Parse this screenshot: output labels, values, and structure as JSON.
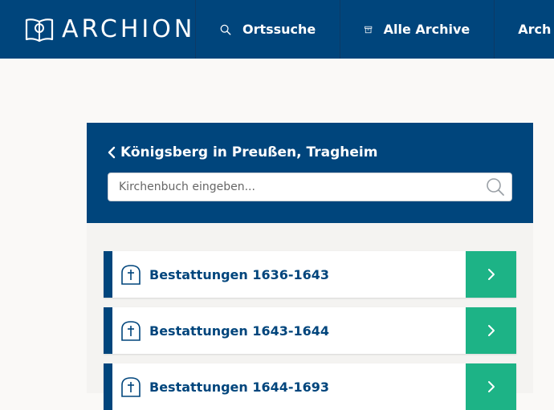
{
  "header": {
    "logo_text": "ARCHION",
    "nav": [
      {
        "label": "Ortssuche",
        "icon": "search-icon"
      },
      {
        "label": "Alle Archive",
        "icon": "archive-box-icon"
      },
      {
        "label": "Arch"
      }
    ]
  },
  "panel": {
    "back_title": "Königsberg in Preußen, Tragheim",
    "search_placeholder": "Kirchenbuch eingeben...",
    "items": [
      {
        "label": "Bestattungen 1636-1643",
        "icon": "cross-tombstone-icon"
      },
      {
        "label": "Bestattungen 1643-1644",
        "icon": "cross-tombstone-icon"
      },
      {
        "label": "Bestattungen 1644-1693",
        "icon": "cross-tombstone-icon"
      }
    ]
  },
  "colors": {
    "brand_blue": "#00457c",
    "accent_green": "#1db386",
    "background": "#faf9f7"
  }
}
